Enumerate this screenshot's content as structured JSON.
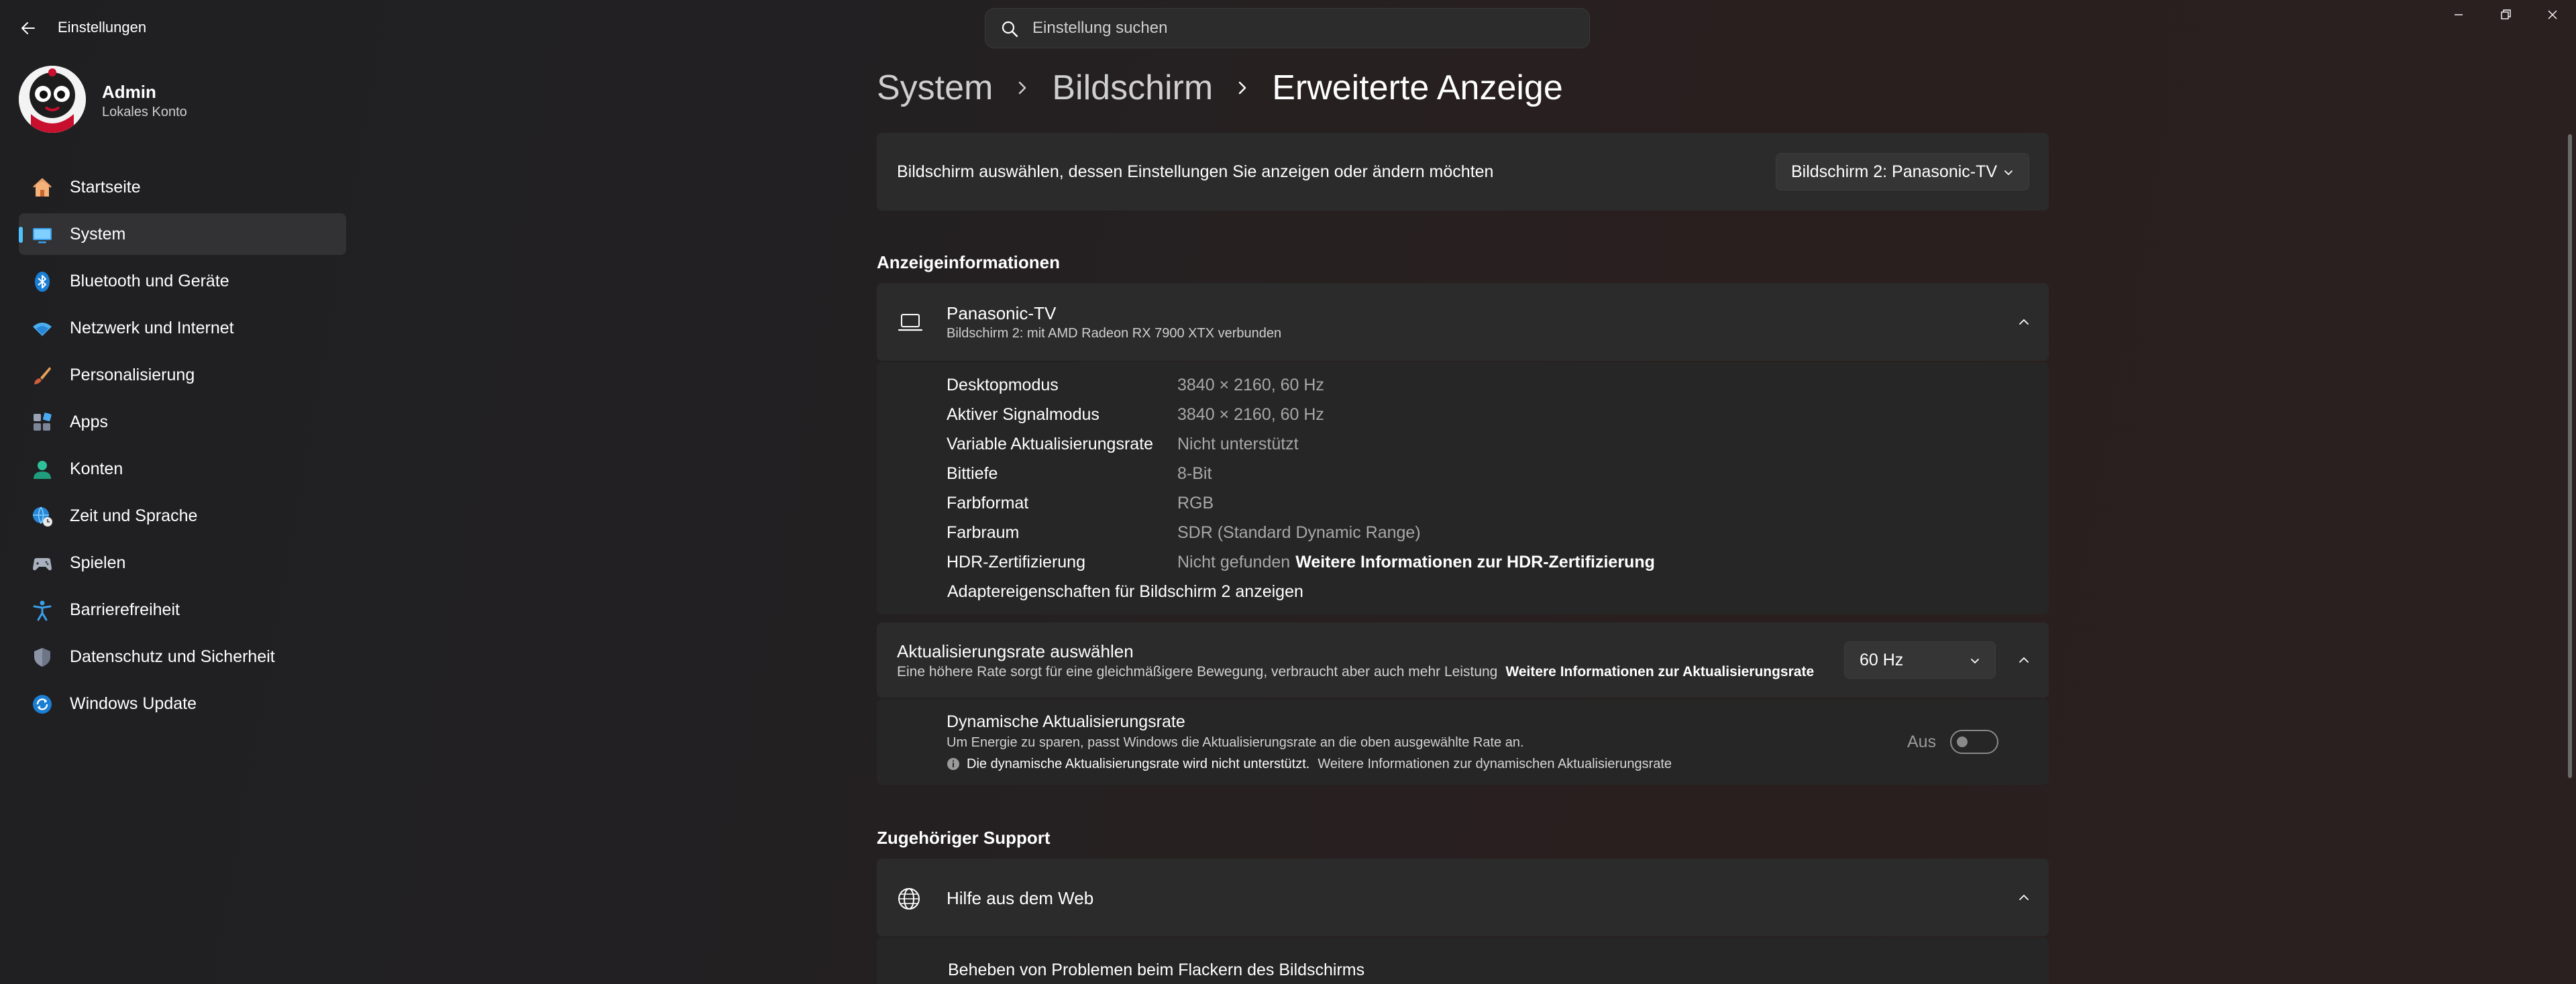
{
  "app": {
    "title": "Einstellungen",
    "search_placeholder": "Einstellung suchen"
  },
  "profile": {
    "name": "Admin",
    "account_type": "Lokales Konto"
  },
  "sidebar": {
    "items": [
      {
        "label": "Startseite",
        "icon": "home-icon",
        "active": false
      },
      {
        "label": "System",
        "icon": "system-icon",
        "active": true
      },
      {
        "label": "Bluetooth und Geräte",
        "icon": "bluetooth-icon",
        "active": false
      },
      {
        "label": "Netzwerk und Internet",
        "icon": "wifi-icon",
        "active": false
      },
      {
        "label": "Personalisierung",
        "icon": "brush-icon",
        "active": false
      },
      {
        "label": "Apps",
        "icon": "apps-icon",
        "active": false
      },
      {
        "label": "Konten",
        "icon": "account-icon",
        "active": false
      },
      {
        "label": "Zeit und Sprache",
        "icon": "globe-clock-icon",
        "active": false
      },
      {
        "label": "Spielen",
        "icon": "gamepad-icon",
        "active": false
      },
      {
        "label": "Barrierefreiheit",
        "icon": "accessibility-icon",
        "active": false
      },
      {
        "label": "Datenschutz und Sicherheit",
        "icon": "shield-icon",
        "active": false
      },
      {
        "label": "Windows Update",
        "icon": "update-icon",
        "active": false
      }
    ]
  },
  "breadcrumb": [
    "System",
    "Bildschirm",
    "Erweiterte Anzeige"
  ],
  "display_select": {
    "label": "Bildschirm auswählen, dessen Einstellungen Sie anzeigen oder ändern möchten",
    "value": "Bildschirm 2: Panasonic-TV"
  },
  "display_info": {
    "section_title": "Anzeigeinformationen",
    "name": "Panasonic-TV",
    "subtitle": "Bildschirm 2: mit AMD Radeon RX 7900 XTX verbunden",
    "rows": [
      {
        "label": "Desktopmodus",
        "value": "3840 × 2160, 60 Hz"
      },
      {
        "label": "Aktiver Signalmodus",
        "value": "3840 × 2160, 60 Hz"
      },
      {
        "label": "Variable Aktualisierungsrate",
        "value": "Nicht unterstützt"
      },
      {
        "label": "Bittiefe",
        "value": "8-Bit"
      },
      {
        "label": "Farbformat",
        "value": "RGB"
      },
      {
        "label": "Farbraum",
        "value": "SDR (Standard Dynamic Range)"
      },
      {
        "label": "HDR-Zertifizierung",
        "value": "Nicht gefunden",
        "link": "Weitere Informationen zur HDR-Zertifizierung"
      }
    ],
    "adapter_link": "Adaptereigenschaften für Bildschirm 2 anzeigen"
  },
  "refresh_rate": {
    "title": "Aktualisierungsrate auswählen",
    "description": "Eine höhere Rate sorgt für eine gleichmäßigere Bewegung, verbraucht aber auch mehr Leistung",
    "link": "Weitere Informationen zur Aktualisierungsrate",
    "value": "60 Hz",
    "dynamic": {
      "title": "Dynamische Aktualisierungsrate",
      "description": "Um Energie zu sparen, passt Windows die Aktualisierungsrate an die oben ausgewählte Rate an.",
      "warning": "Die dynamische Aktualisierungsrate wird nicht unterstützt.",
      "link": "Weitere Informationen zur dynamischen Aktualisierungsrate",
      "toggle_label": "Aus",
      "toggle_on": false
    }
  },
  "support": {
    "section_title": "Zugehöriger Support",
    "help_title": "Hilfe aus dem Web",
    "help_link": "Beheben von Problemen beim Flackern des Bildschirms"
  },
  "colors": {
    "accent": "#4cc2ff",
    "card": "#2b2b2b",
    "muted_text": "#a8a8a8"
  }
}
